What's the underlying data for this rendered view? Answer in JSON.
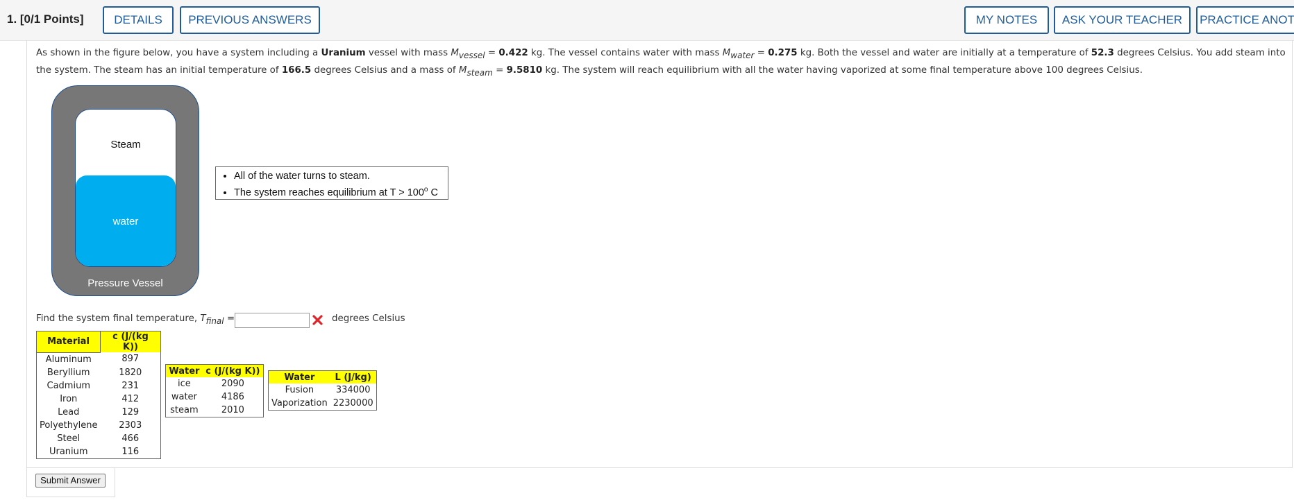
{
  "header": {
    "question_label": "1.  [0/1 Points]",
    "buttons": {
      "details": "DETAILS",
      "previous_answers": "PREVIOUS ANSWERS",
      "my_notes": "MY NOTES",
      "ask_teacher": "ASK YOUR TEACHER",
      "practice_another": "PRACTICE ANOTHER"
    }
  },
  "problem": {
    "t1": "As shown in the figure below, you have a system including a ",
    "material": "Uranium",
    "t2": " vessel with mass ",
    "m_vessel_sym": "M",
    "m_vessel_sub": "vessel",
    "eq1": " = ",
    "m_vessel_val": "0.422",
    "t3": " kg. The vessel contains water with mass ",
    "m_water_sym": "M",
    "m_water_sub": "water",
    "eq2": " = ",
    "m_water_val": "0.275",
    "t4": " kg. Both the vessel and water are initially at a temperature of ",
    "t_init_val": "52.3",
    "t5": " degrees Celsius. You add steam into the system. The steam has an initial temperature of ",
    "t_steam_val": "166.5",
    "t6": " degrees Celsius and a mass of ",
    "m_steam_sym": "M",
    "m_steam_sub": "steam",
    "eq3": " = ",
    "m_steam_val": "9.5810",
    "t7": " kg. The system will reach equilibrium with all the water having vaporized at some final temperature above 100 degrees Celsius."
  },
  "figure": {
    "steam_label": "Steam",
    "water_label": "water",
    "vessel_label": "Pressure Vessel",
    "notes": [
      "All of the water turns to steam.",
      "The system reaches equilibrium at T > 100"
    ],
    "deg_sup": "o",
    "deg_unit": " C",
    "colors": {
      "vessel": "#777777",
      "water": "#00aeef",
      "border": "#1f4e8c"
    }
  },
  "question": {
    "prefix": "Find the system final temperature, ",
    "sym": "T",
    "sub": "final",
    "eq": " =",
    "answer_value": "",
    "status_icon": "x-mark-icon",
    "units": "degrees Celsius"
  },
  "tables": {
    "materials": {
      "headers": [
        "Material",
        "c (J/(kg K))"
      ],
      "rows": [
        [
          "Aluminum",
          "897"
        ],
        [
          "Beryllium",
          "1820"
        ],
        [
          "Cadmium",
          "231"
        ],
        [
          "Iron",
          "412"
        ],
        [
          "Lead",
          "129"
        ],
        [
          "Polyethylene",
          "2303"
        ],
        [
          "Steel",
          "466"
        ],
        [
          "Uranium",
          "116"
        ]
      ]
    },
    "water_c": {
      "headers": [
        "Water",
        "c (J/(kg K))"
      ],
      "rows": [
        [
          "ice",
          "2090"
        ],
        [
          "water",
          "4186"
        ],
        [
          "steam",
          "2010"
        ]
      ]
    },
    "water_l": {
      "headers": [
        "Water",
        "L (J/kg)"
      ],
      "rows": [
        [
          "Fusion",
          "334000"
        ],
        [
          "Vaporization",
          "2230000"
        ]
      ]
    },
    "header_color": "#ffff00"
  },
  "submit": {
    "label": "Submit Answer"
  }
}
